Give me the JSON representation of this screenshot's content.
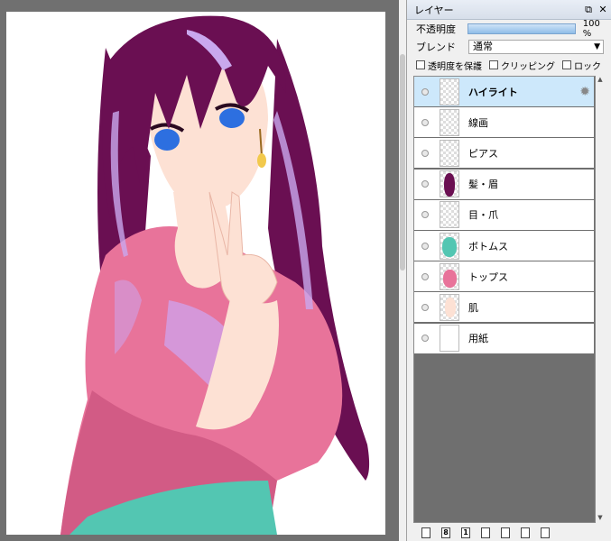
{
  "panel": {
    "title": "レイヤー",
    "buttons": {
      "float": "⧉",
      "close": "✕"
    },
    "opacity": {
      "label": "不透明度",
      "value": "100 %",
      "fraction": 1.0
    },
    "blend": {
      "label": "ブレンド",
      "value": "通常"
    },
    "options": {
      "preserve_opacity": "透明度を保護",
      "clipping": "クリッピング",
      "lock": "ロック"
    },
    "layers": [
      {
        "name": "ハイライト",
        "selected": true,
        "thumb": "empty"
      },
      {
        "name": "線画",
        "selected": false,
        "thumb": "empty"
      },
      {
        "name": "ピアス",
        "selected": false,
        "thumb": "empty"
      },
      {
        "name": "髪・眉",
        "selected": false,
        "thumb": "hair"
      },
      {
        "name": "目・爪",
        "selected": false,
        "thumb": "empty"
      },
      {
        "name": "ボトムス",
        "selected": false,
        "thumb": "bottoms"
      },
      {
        "name": "トップス",
        "selected": false,
        "thumb": "tops"
      },
      {
        "name": "肌",
        "selected": false,
        "thumb": "skin"
      },
      {
        "name": "用紙",
        "selected": false,
        "thumb": "paper"
      }
    ],
    "toolbar": [
      {
        "name": "new-raster-layer-button",
        "glyph": ""
      },
      {
        "name": "new-8bit-layer-button",
        "glyph": "8"
      },
      {
        "name": "new-1bit-layer-button",
        "glyph": "1"
      },
      {
        "name": "new-folder-button",
        "glyph": ""
      },
      {
        "name": "duplicate-layer-button",
        "glyph": ""
      },
      {
        "name": "merge-down-button",
        "glyph": ""
      },
      {
        "name": "delete-layer-button",
        "glyph": ""
      }
    ]
  },
  "colors": {
    "selected_row": "#cde8fb",
    "hair": "#6a0f52",
    "hair_highlight": "#c9a8ee",
    "top": "#e8739a",
    "top_shadow": "#c9517c",
    "top_light": "#cfa0e8",
    "skin": "#fde1d4",
    "skin_shadow": "#e9b6a6",
    "bottoms": "#53c6b2",
    "eyes": "#2d6fe0"
  }
}
